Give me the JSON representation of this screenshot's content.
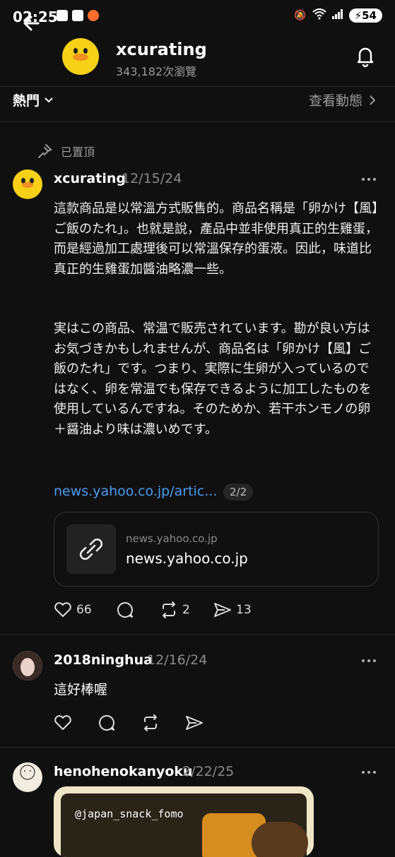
{
  "status": {
    "time": "02:25",
    "battery": "54"
  },
  "header": {
    "title": "xcurating",
    "subtitle": "343,182次瀏覽"
  },
  "tabs": {
    "hot": "熱門",
    "activity": "查看動態"
  },
  "pinned_label": "已置頂",
  "post": {
    "user": "xcurating",
    "date": "12/15/24",
    "para1": "這款商品是以常溫方式販售的。商品名稱是「卵かけ【風】ご飯のたれ」。也就是說，產品中並非使用真正的生雞蛋，而是經過加工處理後可以常溫保存的蛋液。因此，味道比真正的生雞蛋加醬油略濃一些。",
    "para2": "実はこの商品、常温で販売されています。勘が良い方はお気づきかもしれませんが、商品名は「卵かけ【風】ご飯のたれ」です。つまり、実際に生卵が入っているのではなく、卵を常温でも保存できるように加工したものを使用しているんですね。そのためか、若干ホンモノの卵＋醤油より味は濃いめです。",
    "link": "news.yahoo.co.jp/artic...",
    "pager": "2/2",
    "card_domain": "news.yahoo.co.jp",
    "card_title": "news.yahoo.co.jp",
    "likes": "66",
    "reposts": "2",
    "shares": "13"
  },
  "reply1": {
    "user": "2018ninghua",
    "date": "12/16/24",
    "text": "這好棒喔"
  },
  "reply2": {
    "user": "henohenokanyoku",
    "date": "2/22/25",
    "media_tag": "@japan_snack_fomo"
  }
}
